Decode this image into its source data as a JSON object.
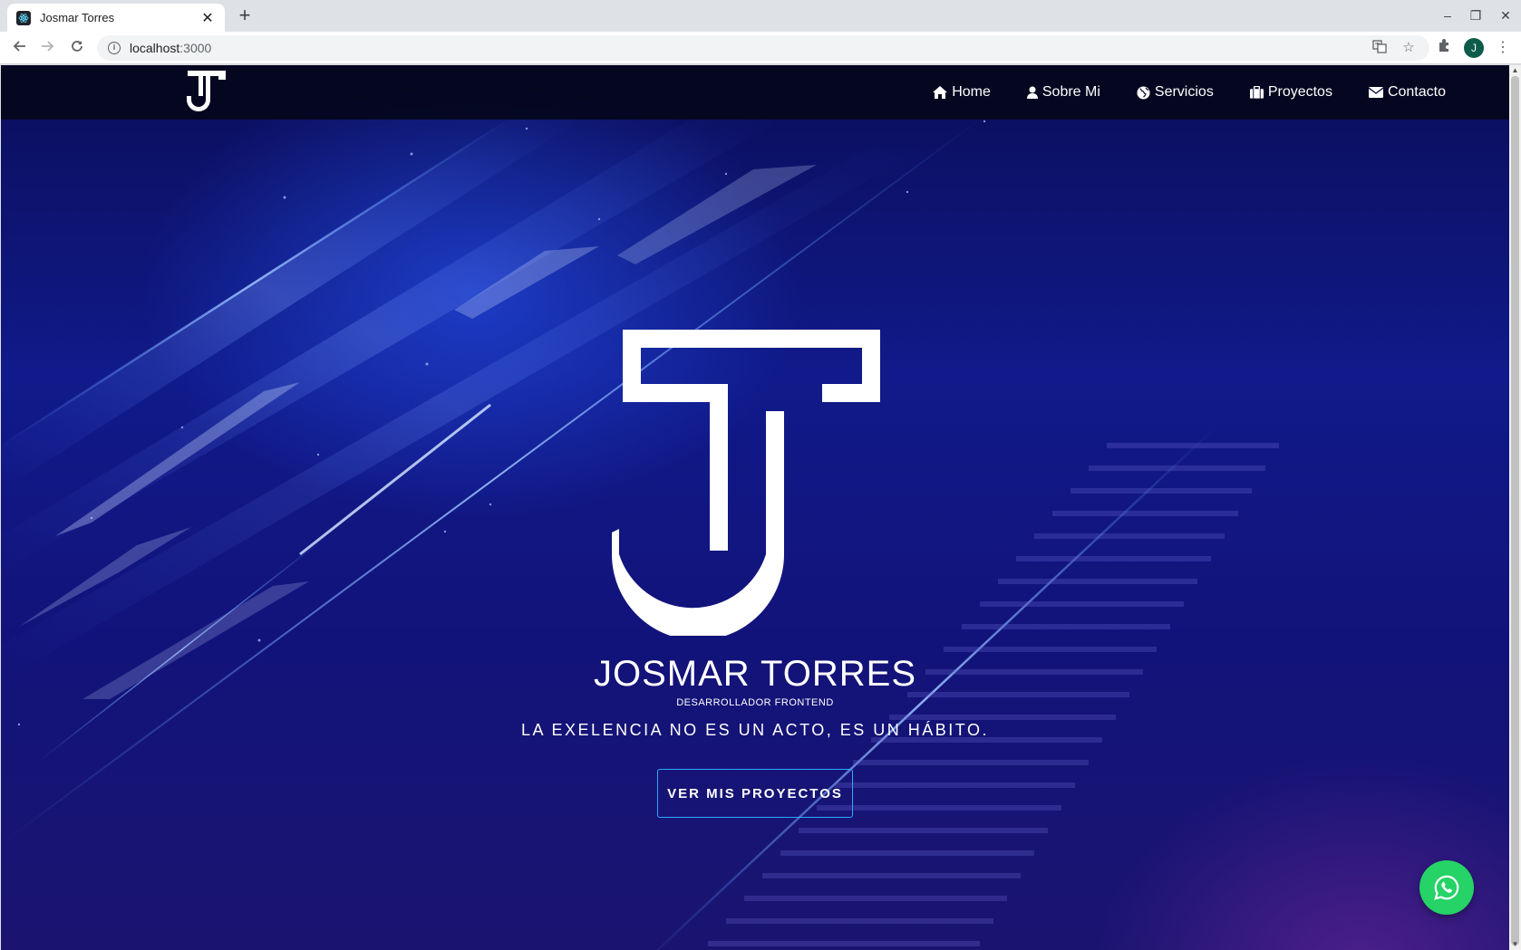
{
  "browser": {
    "tab_title": "Josmar Torres",
    "tab_close": "✕",
    "new_tab": "+",
    "url_host": "localhost",
    "url_port": ":3000",
    "profile_initial": "J",
    "window_controls": {
      "minimize": "–",
      "restore": "❐",
      "close": "✕"
    }
  },
  "nav": {
    "items": [
      {
        "label": "Home",
        "icon": "home-icon"
      },
      {
        "label": "Sobre Mi",
        "icon": "user-icon"
      },
      {
        "label": "Servicios",
        "icon": "globe-icon"
      },
      {
        "label": "Proyectos",
        "icon": "briefcase-icon"
      },
      {
        "label": "Contacto",
        "icon": "envelope-icon"
      }
    ]
  },
  "hero": {
    "name": "JOSMAR TORRES",
    "role": "DESARROLLADOR FRONTEND",
    "quote": "LA EXELENCIA NO ES UN ACTO, ES UN HÁBITO.",
    "cta_label": "VER MIS PROYECTOS"
  },
  "colors": {
    "accent": "#2ea8ff",
    "whatsapp": "#25d366",
    "navbar": "#04061a",
    "background_deep": "#0b0e5a"
  }
}
